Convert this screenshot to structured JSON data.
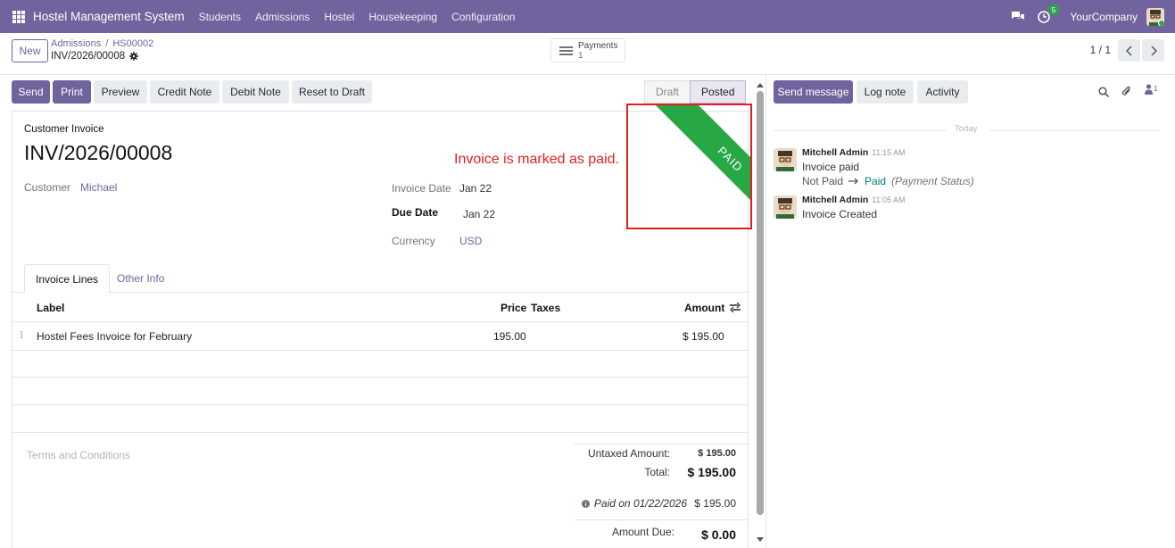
{
  "navbar": {
    "app_title": "Hostel Management System",
    "menu": [
      "Students",
      "Admissions",
      "Hostel",
      "Housekeeping",
      "Configuration"
    ],
    "activity_count": "5",
    "company": "YourCompany"
  },
  "control": {
    "new_label": "New",
    "breadcrumb": [
      "Admissions",
      "HS00002"
    ],
    "record_name": "INV/2026/00008",
    "payments_label": "Payments",
    "payments_count": "1",
    "pager": "1 / 1"
  },
  "actions": {
    "send": "Send",
    "print": "Print",
    "preview": "Preview",
    "credit_note": "Credit Note",
    "debit_note": "Debit Note",
    "reset_to_draft": "Reset to Draft"
  },
  "status": {
    "draft": "Draft",
    "posted": "Posted"
  },
  "form": {
    "type_label": "Customer Invoice",
    "number": "INV/2026/00008",
    "customer_label": "Customer",
    "customer_value": "Michael",
    "invoice_date_label": "Invoice Date",
    "invoice_date_value": "Jan 22",
    "due_date_label": "Due Date",
    "due_date_value": "Jan 22",
    "currency_label": "Currency",
    "currency_value": "USD",
    "annotation": "Invoice is marked as paid.",
    "ribbon": "PAID"
  },
  "tabs": [
    "Invoice Lines",
    "Other Info"
  ],
  "table": {
    "headers": {
      "label": "Label",
      "price": "Price",
      "taxes": "Taxes",
      "amount": "Amount"
    },
    "rows": [
      {
        "label": "Hostel Fees Invoice for February",
        "price": "195.00",
        "taxes": "",
        "amount": "$ 195.00"
      }
    ]
  },
  "terms": "Terms and Conditions",
  "totals": {
    "untaxed_label": "Untaxed Amount:",
    "untaxed_value": "$ 195.00",
    "total_label": "Total:",
    "total_value": "$ 195.00",
    "paid_on": "Paid on 01/22/2026",
    "paid_value": "$ 195.00",
    "due_label": "Amount Due:",
    "due_value": "$ 0.00"
  },
  "chatter": {
    "send_message": "Send message",
    "log_note": "Log note",
    "activity": "Activity",
    "followers_count": "1",
    "date_separator": "Today",
    "messages": [
      {
        "author": "Mitchell Admin",
        "time": "11:15 AM",
        "body": "Invoice paid",
        "tracking": {
          "old": "Not Paid",
          "new": "Paid",
          "field": "(Payment Status)"
        }
      },
      {
        "author": "Mitchell Admin",
        "time": "11:05 AM",
        "body": "Invoice Created"
      }
    ]
  },
  "colors": {
    "brand": "#71639e",
    "paid_ribbon": "#28a745",
    "annotation": "#e02020"
  }
}
